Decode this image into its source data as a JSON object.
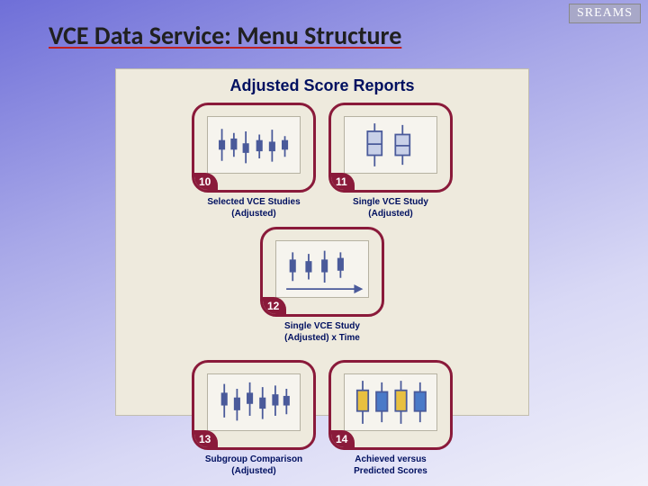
{
  "brand": "SREAMS",
  "slide_title": "VCE Data Service: Menu Structure",
  "panel": {
    "title": "Adjusted Score Reports",
    "cards": [
      {
        "num": "10",
        "caption_l1": "Selected VCE Studies",
        "caption_l2": "(Adjusted)"
      },
      {
        "num": "11",
        "caption_l1": "Single VCE Study",
        "caption_l2": "(Adjusted)"
      },
      {
        "num": "12",
        "caption_l1": "Single VCE Study",
        "caption_l2": "(Adjusted) x Time"
      },
      {
        "num": "13",
        "caption_l1": "Subgroup Comparison",
        "caption_l2": "(Adjusted)"
      },
      {
        "num": "14",
        "caption_l1": "Achieved versus",
        "caption_l2": "Predicted Scores"
      }
    ]
  }
}
